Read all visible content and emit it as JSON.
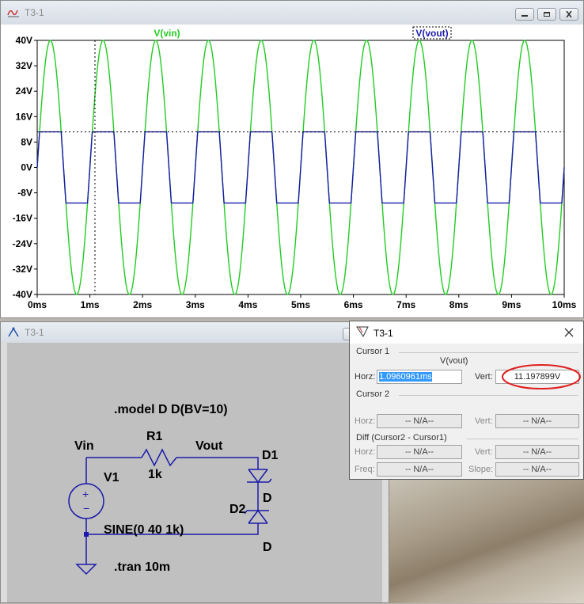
{
  "plot_window": {
    "title": "T3-1",
    "traces": [
      {
        "name": "V(vin)",
        "color": "#22cc22"
      },
      {
        "name": "V(vout)",
        "color": "#1a1aaa"
      }
    ],
    "y_ticks": [
      "40V",
      "32V",
      "24V",
      "16V",
      "8V",
      "0V",
      "-8V",
      "-16V",
      "-24V",
      "-32V",
      "-40V"
    ],
    "x_ticks": [
      "0ms",
      "1ms",
      "2ms",
      "3ms",
      "4ms",
      "5ms",
      "6ms",
      "7ms",
      "8ms",
      "9ms",
      "10ms"
    ]
  },
  "chart_data": {
    "type": "line",
    "x_unit": "ms",
    "xlim": [
      0,
      10
    ],
    "ylim": [
      -40,
      40
    ],
    "series": [
      {
        "name": "V(vin)",
        "function": "40*sin(2*pi*1*t_ms)",
        "amplitude": 40,
        "frequency_khz": 1,
        "color": "#22cc22"
      },
      {
        "name": "V(vout)",
        "function": "clip(vin,-11.197899,11.197899)",
        "clip_level": 11.197899,
        "color": "#1a1aaa"
      }
    ],
    "cursor": {
      "x_ms": 1.0960961,
      "y_v": 11.197899
    },
    "grid": false
  },
  "schematic_window": {
    "title": "T3-1",
    "labels": {
      "model": ".model D D(BV=10)",
      "vin": "Vin",
      "r1": "R1",
      "r1_value": "1k",
      "vout": "Vout",
      "d1": "D1",
      "d1_model": "D",
      "d2": "D2",
      "d2_model": "D",
      "v1": "V1",
      "v1_value": "SINE(0 40 1k)",
      "tran": ".tran 10m"
    }
  },
  "cursor_window": {
    "title": "T3-1",
    "cursor1_label": "Cursor 1",
    "trace_name": "V(vout)",
    "horz_label": "Horz:",
    "horz_value": "1.0960961ms",
    "vert_label": "Vert:",
    "vert_value": "11.197899V",
    "cursor2_label": "Cursor 2",
    "c2_horz_label": "Horz:",
    "c2_horz_value": "-- N/A--",
    "c2_vert_label": "Vert:",
    "c2_vert_value": "-- N/A--",
    "diff_label": "Diff (Cursor2 - Cursor1)",
    "d_horz_label": "Horz:",
    "d_horz_value": "-- N/A--",
    "d_vert_label": "Vert:",
    "d_vert_value": "-- N/A--",
    "freq_label": "Freq:",
    "freq_value": "-- N/A--",
    "slope_label": "Slope:",
    "slope_value": "-- N/A--"
  }
}
